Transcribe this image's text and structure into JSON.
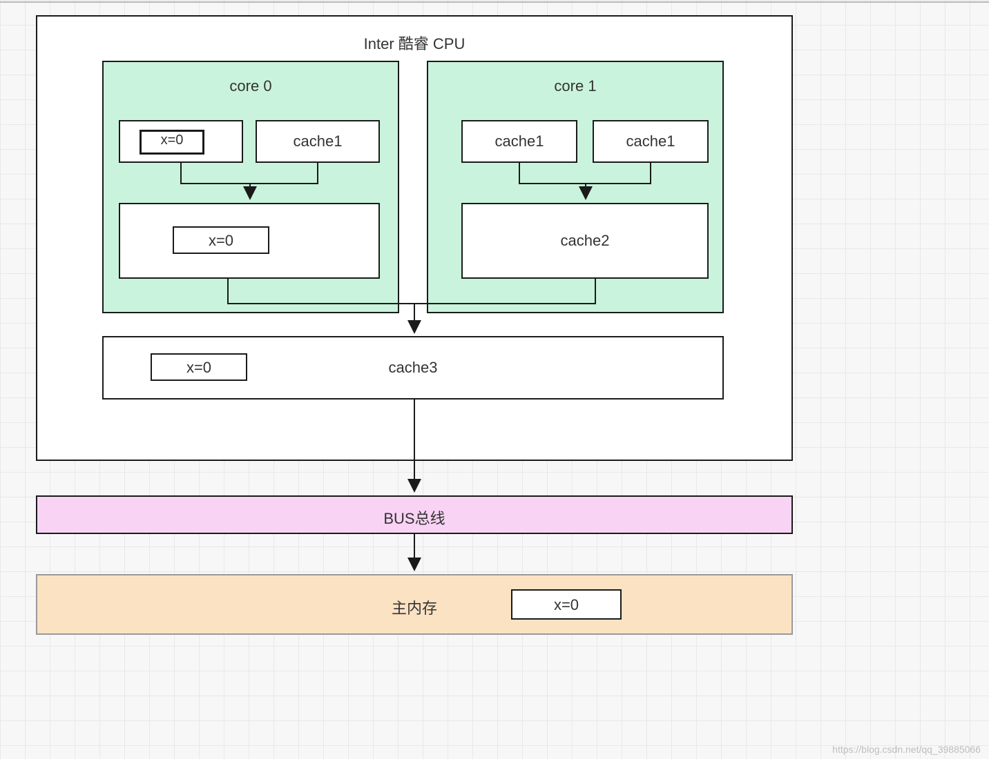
{
  "cpu": {
    "title": "Inter 酷睿 CPU",
    "cores": [
      {
        "name": "core 0",
        "top_left": {
          "label": "x=0",
          "inner_label": "x=0"
        },
        "top_right": {
          "label": "cache1"
        },
        "l2": {
          "label": "x=0"
        }
      },
      {
        "name": "core 1",
        "top_left": {
          "label": "cache1"
        },
        "top_right": {
          "label": "cache1"
        },
        "l2": {
          "label": "cache2"
        }
      }
    ],
    "l3": {
      "label": "cache3",
      "value": "x=0"
    }
  },
  "bus": {
    "label": "BUS总线"
  },
  "memory": {
    "label": "主内存",
    "value": "x=0"
  },
  "watermark": "https://blog.csdn.net/qq_39885066"
}
